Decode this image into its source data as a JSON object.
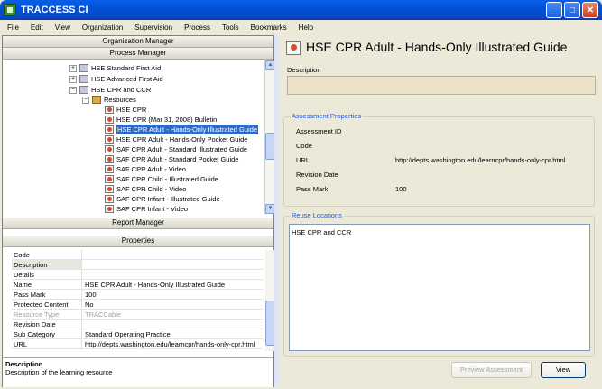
{
  "window": {
    "title": "TRACCESS CI"
  },
  "menu": [
    "File",
    "Edit",
    "View",
    "Organization",
    "Supervision",
    "Process",
    "Tools",
    "Bookmarks",
    "Help"
  ],
  "left": {
    "org_manager": "Organization Manager",
    "process_manager": "Process Manager",
    "report_manager": "Report Manager",
    "properties_header": "Properties",
    "tree": [
      {
        "label": "HSE  Standard First Aid",
        "expander": "+",
        "icon": "folder-icon"
      },
      {
        "label": "HSE  Advanced First Aid",
        "expander": "+",
        "icon": "folder-icon"
      },
      {
        "label": "HSE  CPR and CCR",
        "expander": "−",
        "icon": "folder-icon"
      },
      {
        "label": "Resources",
        "expander": "−",
        "icon": "resources-icon"
      },
      {
        "label": "HSE  CPR",
        "icon": "document-icon"
      },
      {
        "label": "HSE  CPR (Mar 31, 2008) Bulletin",
        "icon": "document-icon"
      },
      {
        "label": "HSE  CPR Adult - Hands-Only Illustrated Guide",
        "icon": "document-icon",
        "selected": true
      },
      {
        "label": "HSE  CPR Adult - Hands-Only Pocket Guide",
        "icon": "document-icon"
      },
      {
        "label": "SAF  CPR Adult - Standard Illustrated Guide",
        "icon": "document-icon"
      },
      {
        "label": "SAF  CPR Adult - Standard Pocket Guide",
        "icon": "document-icon"
      },
      {
        "label": "SAF  CPR Adult - Video",
        "icon": "document-icon"
      },
      {
        "label": "SAF  CPR Child - Illustrated Guide",
        "icon": "document-icon"
      },
      {
        "label": "SAF  CPR Child - Video",
        "icon": "document-icon"
      },
      {
        "label": "SAF  CPR Infant - Illustrated Guide",
        "icon": "document-icon"
      },
      {
        "label": "SAF  CPR Infant - Video",
        "icon": "document-icon"
      }
    ],
    "properties": [
      {
        "key": "Code",
        "value": ""
      },
      {
        "key": "Description",
        "value": "",
        "selected": true
      },
      {
        "key": "Details",
        "value": ""
      },
      {
        "key": "Name",
        "value": "HSE  CPR Adult - Hands-Only Illustrated Guide"
      },
      {
        "key": "Pass Mark",
        "value": "100"
      },
      {
        "key": "Protected Content",
        "value": "No"
      },
      {
        "key": "Resource Type",
        "value": "TRACCable",
        "disabled": true
      },
      {
        "key": "Revision Date",
        "value": ""
      },
      {
        "key": "Sub Category",
        "value": "Standard Operating Practice"
      },
      {
        "key": "URL",
        "value": "http://depts.washington.edu/learncpr/hands-only-cpr.html"
      }
    ],
    "description_box": {
      "title": "Description",
      "text": "Description of the learning resource"
    }
  },
  "right": {
    "title": "HSE  CPR Adult - Hands-Only Illustrated Guide",
    "description_label": "Description",
    "description_value": "",
    "assessment": {
      "group_title": "Assessment Properties",
      "rows": [
        {
          "key": "Assessment ID",
          "value": ""
        },
        {
          "key": "Code",
          "value": ""
        },
        {
          "key": "URL",
          "value": "http://depts.washington.edu/learncpr/hands-only-cpr.html"
        },
        {
          "key": "Revision Date",
          "value": ""
        },
        {
          "key": "Pass Mark",
          "value": "100"
        }
      ]
    },
    "reuse": {
      "group_title": "Reuse Locations",
      "items": [
        "HSE  CPR and CCR"
      ]
    },
    "buttons": {
      "preview": "Preview Assessment",
      "view": "View"
    }
  }
}
